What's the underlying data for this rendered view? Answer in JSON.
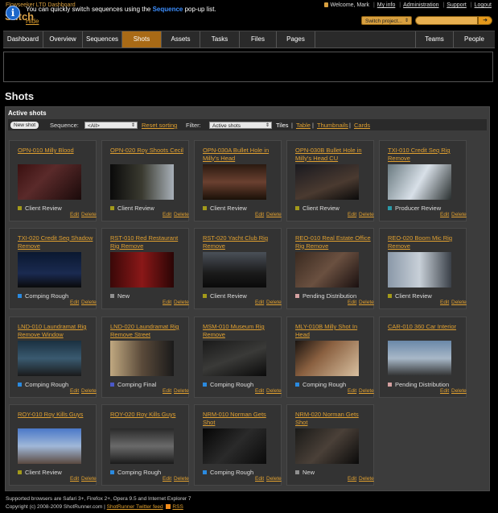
{
  "header": {
    "brand_line": "Flowseeker LTD Dashboard",
    "app_title": "Stitch",
    "welcome": "Welcome, Mark",
    "my_info": "My info",
    "administration": "Administration",
    "support": "Support",
    "logout": "Logout",
    "switch_project": "Switch project..."
  },
  "tabs": [
    "Dashboard",
    "Overview",
    "Sequences",
    "Shots",
    "Assets",
    "Tasks",
    "Files",
    "Pages",
    "Teams",
    "People"
  ],
  "info": {
    "text_pre": "You can quickly switch sequences using the ",
    "text_hl": "Sequence",
    "text_post": " pop-up list.",
    "hide": "Hide"
  },
  "page_title": "Shots",
  "panel_title": "Active shots",
  "toolbar": {
    "new_shot": "New shot",
    "sequence_label": "Sequence:",
    "sequence_value": "<All>",
    "reset_sorting": "Reset sorting",
    "filter_label": "Filter:",
    "filter_value": "Active shots",
    "tiles": "Tiles",
    "table": "Table",
    "thumbnails": "Thumbnails",
    "cards": "Cards"
  },
  "actions": {
    "edit": "Edit",
    "delete": "Delete"
  },
  "status_colors": {
    "Client Review": "#a39a1a",
    "Producer Review": "#2a9aa8",
    "Comping Rough": "#2a8ae0",
    "New": "#909090",
    "Pending Distribution": "#d4a0a0",
    "Comping Final": "#4a58c8"
  },
  "shots": [
    {
      "title": "OPN-010 Milly Blood",
      "status": "Client Review"
    },
    {
      "title": "OPN-020 Roy Shoots Cecil",
      "status": "Client Review"
    },
    {
      "title": "OPN-030A Bullet Hole in Milly's Head",
      "status": "Client Review"
    },
    {
      "title": "OPN-030B Bullet Hole in Milly's Head CU",
      "status": "Client Review"
    },
    {
      "title": "TXI-010 Credit Seq Rig Remove",
      "status": "Producer Review"
    },
    {
      "title": "TXI-020 Credit Seq Shadow Remove",
      "status": "Comping Rough"
    },
    {
      "title": "RST-010 Red Restaurant Rig Remove",
      "status": "New"
    },
    {
      "title": "RST-020 Yacht Club Rig Remove",
      "status": "Client Review"
    },
    {
      "title": "REO-010 Real Estate Office Rig Remove",
      "status": "Pending Distribution"
    },
    {
      "title": "REO-020 Boom Mic Rig Remove",
      "status": "Client Review"
    },
    {
      "title": "LND-010 Laundramat Rig Remove Window",
      "status": "Comping Rough"
    },
    {
      "title": "LND-020 Laundramat Rig Remove Street",
      "status": "Comping Final"
    },
    {
      "title": "MSM-010 Museum Rig Remove",
      "status": "Comping Rough"
    },
    {
      "title": "MLY-010B Milly Shot In Head",
      "status": "Comping Rough"
    },
    {
      "title": "CAR-010 360 Car Interior",
      "status": "Pending Distribution"
    },
    {
      "title": "ROY-010 Roy Kills Guys",
      "status": "Client Review"
    },
    {
      "title": "ROY-020 Roy Kills Guys",
      "status": "Comping Rough"
    },
    {
      "title": "NRM-010 Norman Gets Shot",
      "status": "Comping Rough"
    },
    {
      "title": "NRM-020 Norman Gets Shot",
      "status": "New"
    }
  ],
  "footer": {
    "line1": "Supported browsers are Safari 3+, Firefox 2+, Opera 9.5 and Internet Explorer 7",
    "line2": "Copyright (c) 2008-2009 ShotRunner.com |",
    "twitter": "ShotRunner Twitter feed",
    "rss": "RSS"
  }
}
